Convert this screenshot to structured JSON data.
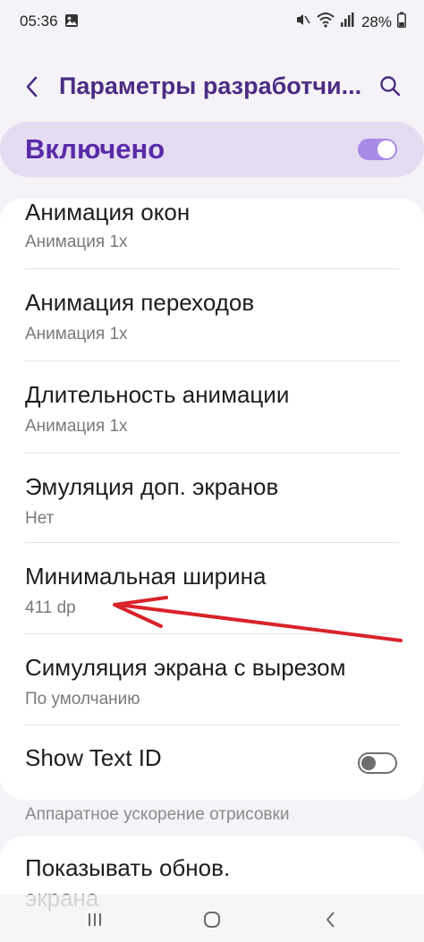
{
  "status_bar": {
    "time": "05:36",
    "battery": "28%",
    "icons": [
      "gallery-icon",
      "mute-icon",
      "wifi-icon",
      "signal-icon",
      "battery-icon"
    ]
  },
  "header": {
    "title": "Параметры разработчи...",
    "back_icon": "chevron-left-icon",
    "search_icon": "search-icon"
  },
  "master_switch": {
    "label": "Включено",
    "state": "on",
    "accent": "#a98ae6"
  },
  "settings": [
    {
      "title": "Анимация окон",
      "subtitle": "Анимация 1x"
    },
    {
      "title": "Анимация переходов",
      "subtitle": "Анимация 1x"
    },
    {
      "title": "Длительность анимации",
      "subtitle": "Анимация 1x"
    },
    {
      "title": "Эмуляция доп. экранов",
      "subtitle": "Нет"
    },
    {
      "title": "Минимальная ширина",
      "subtitle": "411 dp"
    },
    {
      "title": "Симуляция экрана с вырезом",
      "subtitle": "По умолчанию"
    },
    {
      "title": "Show Text ID",
      "toggle": "off"
    }
  ],
  "section": {
    "header": "Аппаратное ускорение отрисовки",
    "first_item_title": "Показывать обнов.",
    "first_item_title_cont": "экрана"
  },
  "nav_bar": {
    "icons": [
      "recents-icon",
      "home-icon",
      "back-icon"
    ]
  },
  "annotation": {
    "arrow_color": "#d9232a"
  }
}
